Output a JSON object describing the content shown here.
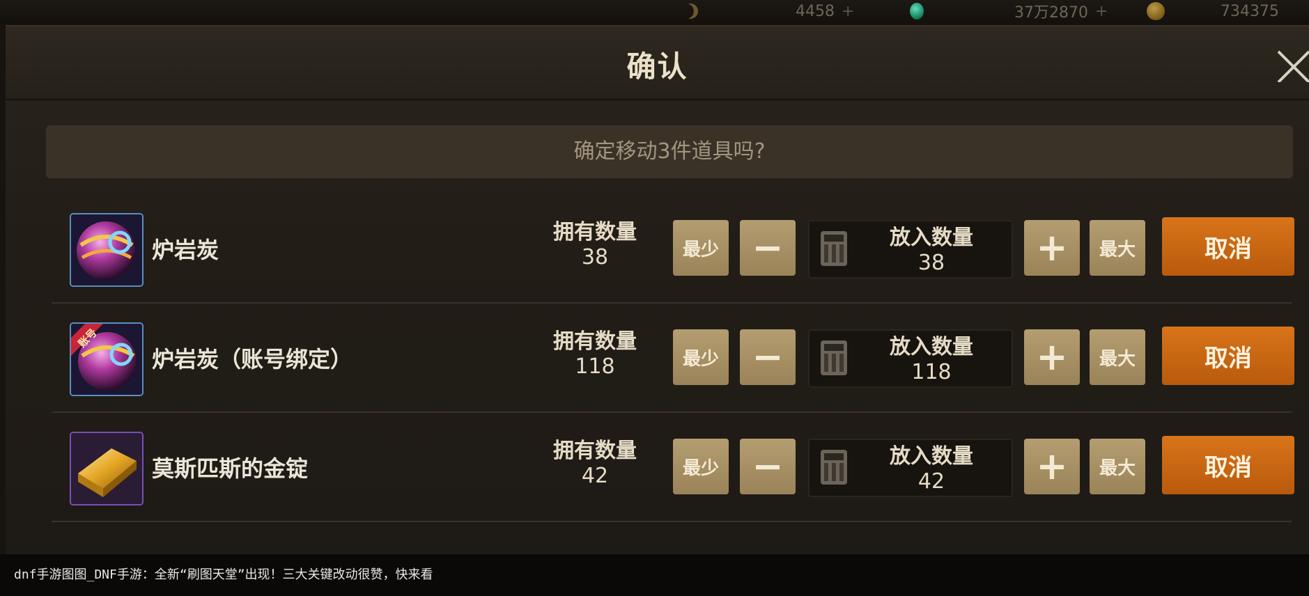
{
  "topbar": {
    "res1_value": "4458",
    "res2_value": "37万2870",
    "res3_value": "734375",
    "plus": "+"
  },
  "dialog": {
    "title": "确认",
    "prompt": "确定移动3件道具吗?"
  },
  "labels": {
    "owned": "拥有数量",
    "put": "放入数量",
    "min": "最少",
    "max": "最大",
    "cancel": "取消"
  },
  "items": [
    {
      "name": "炉岩炭",
      "owned": "38",
      "qty": "38",
      "icon": "lava-coal-icon"
    },
    {
      "name": "炉岩炭（账号绑定）",
      "owned": "118",
      "qty": "118",
      "icon": "lava-coal-bound-icon",
      "badge": "账号"
    },
    {
      "name": "莫斯匹斯的金锭",
      "owned": "42",
      "qty": "42",
      "icon": "gold-ingot-icon"
    }
  ],
  "caption": "dnf手游图图_DNF手游：全新“刷图天堂”出现！三大关键改动很赞，快来看",
  "colors": {
    "cancel": "#d8741a",
    "tan_button": "#b49d71",
    "dialog_bg": "#221d17"
  }
}
